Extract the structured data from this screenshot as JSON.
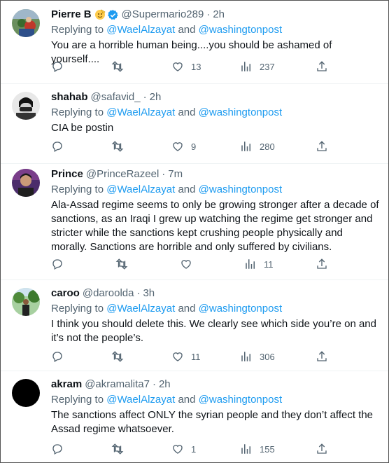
{
  "reply_prefix": "Replying to",
  "reply_and": "and",
  "tweets": [
    {
      "name": "Pierre B",
      "handle": "@Supermario289",
      "dot": "·",
      "time": "2h",
      "badges": [
        "salute-emoji",
        "verified-badge"
      ],
      "mention1": "@WaelAlzayat",
      "mention2": "@washingtonpost",
      "text": "You are a horrible human being....you should be ashamed of yourself....",
      "replies": "",
      "retweets": "",
      "likes": "13",
      "views": "237"
    },
    {
      "name": "shahab",
      "handle": "@safavid_",
      "dot": "·",
      "time": "2h",
      "mention1": "@WaelAlzayat",
      "mention2": "@washingtonpost",
      "text": "CIA be postin",
      "replies": "",
      "retweets": "",
      "likes": "9",
      "views": "280"
    },
    {
      "name": "Prince",
      "handle": "@PrinceRazeel",
      "dot": "·",
      "time": "7m",
      "mention1": "@WaelAlzayat",
      "mention2": "@washingtonpost",
      "text": "Ala-Assad regime seems to only be growing stronger after a decade of sanctions, as an Iraqi I grew up watching the regime get stronger and stricter while the sanctions kept crushing people physically and morally. Sanctions are horrible and only suffered by civilians.",
      "replies": "",
      "retweets": "",
      "likes": "",
      "views": "11"
    },
    {
      "name": "caroo",
      "handle": "@daroolda",
      "dot": "·",
      "time": "3h",
      "mention1": "@WaelAlzayat",
      "mention2": "@washingtonpost",
      "text": "I think you should delete this. We clearly see which side you’re on and it’s not the people’s.",
      "replies": "",
      "retweets": "",
      "likes": "11",
      "views": "306"
    },
    {
      "name": "akram",
      "handle": "@akramalita7",
      "dot": "·",
      "time": "2h",
      "mention1": "@WaelAlzayat",
      "mention2": "@washingtonpost",
      "text": "The sanctions affect ONLY the syrian people and they don’t affect the Assad regime whatsoever.",
      "replies": "",
      "retweets": "",
      "likes": "1",
      "views": "155"
    }
  ],
  "colors": {
    "text": "#0f1419",
    "secondary": "#536471",
    "link": "#1d9bf0",
    "divider": "#eff3f4"
  },
  "icons": [
    "reply-icon",
    "retweet-icon",
    "like-icon",
    "views-icon",
    "share-icon"
  ]
}
